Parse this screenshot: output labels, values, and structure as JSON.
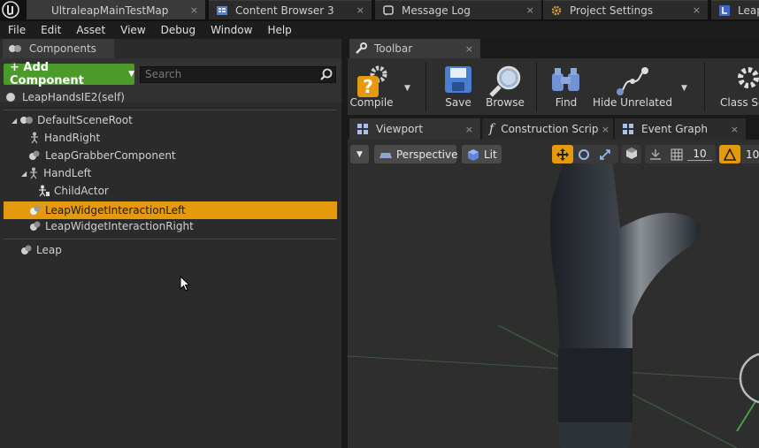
{
  "tabs": [
    {
      "label": "UltraleapMainTestMap",
      "close": "×"
    },
    {
      "label": "Content Browser 3",
      "close": "×"
    },
    {
      "label": "Message Log",
      "close": "×"
    },
    {
      "label": "Project Settings",
      "close": "×"
    },
    {
      "label": "Leap"
    }
  ],
  "menu": [
    "File",
    "Edit",
    "Asset",
    "View",
    "Debug",
    "Window",
    "Help"
  ],
  "components_panel": {
    "tab_label": "Components",
    "add_label": "+ Add Component",
    "search_placeholder": "Search",
    "self_label": "LeapHandsIE2(self)",
    "tree": [
      "DefaultSceneRoot",
      "HandRight",
      "LeapGrabberComponent",
      "HandLeft",
      "ChildActor",
      "LeapWidgetInteractionLeft",
      "LeapWidgetInteractionRight"
    ],
    "selected_index": 5,
    "extra_label": "Leap"
  },
  "toolbar": {
    "tab_label": "Toolbar",
    "buttons": [
      "Compile",
      "Save",
      "Browse",
      "Find",
      "Hide Unrelated",
      "Class Se"
    ]
  },
  "editor_tabs": [
    "Viewport",
    "Construction Scrip",
    "Event Graph"
  ],
  "viewport": {
    "perspective_label": "Perspective",
    "lit_label": "Lit",
    "grid_snap": "10",
    "angle_snap": "10"
  },
  "colors": {
    "selection": "#e59a0e",
    "add_button": "#4c9a2a"
  }
}
